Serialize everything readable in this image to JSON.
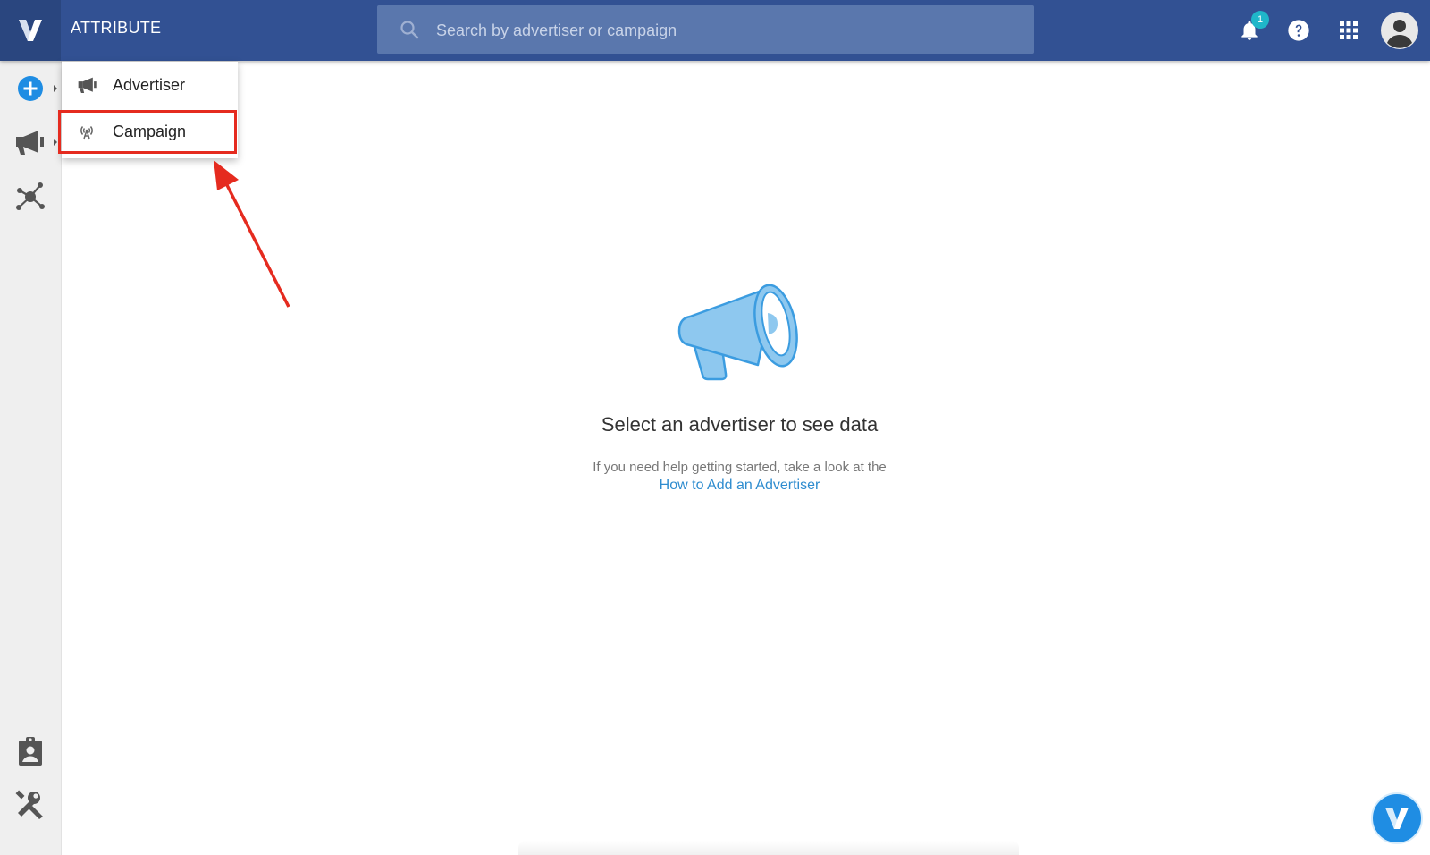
{
  "header": {
    "app_title": "ATTRIBUTE",
    "search_placeholder": "Search by advertiser or campaign",
    "notification_count": "1"
  },
  "icons": {
    "logo": "v-logo-icon",
    "search": "search-icon",
    "notifications": "bell-icon",
    "help": "help-icon",
    "apps": "apps-grid-icon",
    "account": "account-avatar-icon",
    "rail": [
      "add-icon",
      "megaphone-icon",
      "network-icon",
      "assignment-icon",
      "tools-icon"
    ]
  },
  "menu": {
    "items": [
      {
        "label": "Advertiser",
        "icon": "megaphone-icon"
      },
      {
        "label": "Campaign",
        "icon": "broadcast-icon",
        "highlighted": true
      }
    ]
  },
  "empty_state": {
    "title": "Select an advertiser to see data",
    "help_text": "If you need help getting started, take a look at the",
    "link_text": "How to Add an Advertiser"
  },
  "colors": {
    "topbar": "#325193",
    "accent": "#1f8de3",
    "highlight": "#e52b1f",
    "illustration": "#8ec8ef"
  }
}
